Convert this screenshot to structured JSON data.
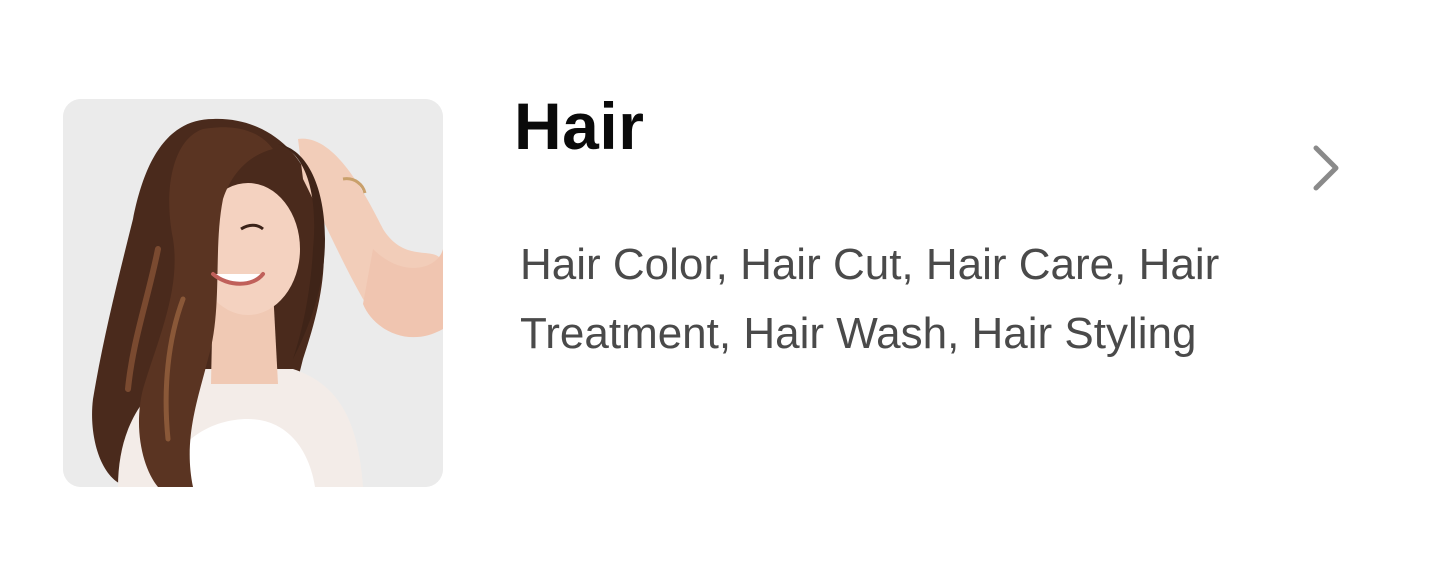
{
  "category": {
    "title": "Hair",
    "services": "Hair Color, Hair Cut, Hair Care, Hair Treatment, Hair Wash, Hair Styling"
  },
  "icons": {
    "chevron": "chevron-right-icon"
  },
  "colors": {
    "title": "#0a0a0a",
    "subtitle": "#4a4a4a",
    "chevron": "#8a8a8a",
    "image_background": "#ebebeb"
  }
}
